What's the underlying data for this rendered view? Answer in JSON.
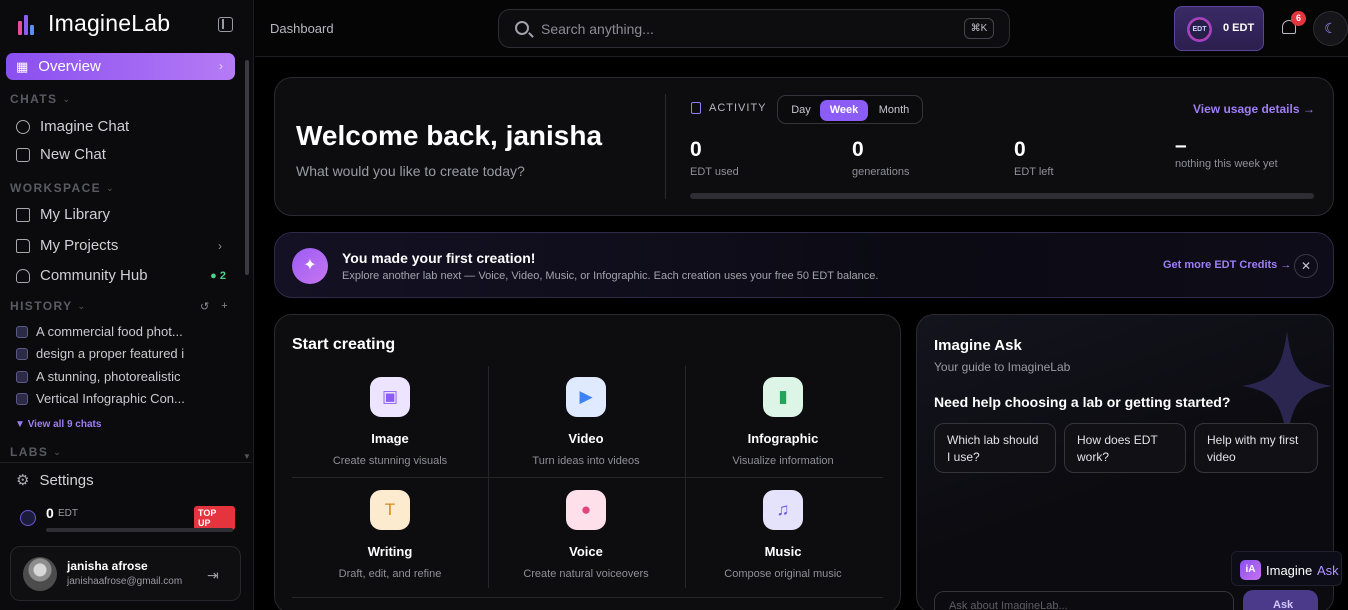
{
  "app": {
    "name": "ImagineLab"
  },
  "sidebar": {
    "overview": "Overview",
    "sections": {
      "chats": "CHATS",
      "workspace": "WORKSPACE",
      "history": "HISTORY",
      "labs": "LABS"
    },
    "chats": [
      "Imagine Chat",
      "New Chat"
    ],
    "workspace": [
      "My Library",
      "My Projects",
      "Community Hub"
    ],
    "community_count": "2",
    "history": [
      "A commercial food phot...",
      "design a proper featured i",
      "A stunning, photorealistic",
      "Vertical Infographic Con..."
    ],
    "view_all": "View all 9 chats",
    "settings": "Settings",
    "edt_balance": "0",
    "edt_unit": "EDT",
    "topup": "TOP UP",
    "user": {
      "name": "janisha afrose",
      "email": "janishaafrose@gmail.com"
    }
  },
  "topbar": {
    "breadcrumb": "Dashboard",
    "search_placeholder": "Search anything...",
    "shortcut": "⌘K",
    "edt_coin": "EDT",
    "edt_label": "0 EDT",
    "notifications": "6"
  },
  "welcome": {
    "title": "Welcome back, janisha",
    "subtitle": "What would you like to create today?",
    "activity_label": "ACTIVITY",
    "tabs": [
      "Day",
      "Week",
      "Month"
    ],
    "active_tab": "Week",
    "usage_link": "View usage details →",
    "stats": [
      {
        "value": "0",
        "label": "EDT used"
      },
      {
        "value": "0",
        "label": "generations"
      },
      {
        "value": "0",
        "label": "EDT left"
      },
      {
        "value": "–",
        "label": "nothing this week yet"
      }
    ],
    "progress": 0
  },
  "banner": {
    "title": "You made your first creation!",
    "subtitle": "Explore another lab next — Voice, Video, Music, or Infographic. Each creation uses your free 50 EDT balance.",
    "link": "Get more EDT Credits →",
    "close": "✕"
  },
  "create": {
    "title": "Start creating",
    "tiles": [
      {
        "name": "Image",
        "desc": "Create stunning visuals",
        "icon": "image-icon",
        "color": "#8b5cf6",
        "bg": "#ede4ff"
      },
      {
        "name": "Video",
        "desc": "Turn ideas into videos",
        "icon": "video-icon",
        "color": "#3b82f6",
        "bg": "#dfeaff"
      },
      {
        "name": "Infographic",
        "desc": "Visualize information",
        "icon": "bar-chart-icon",
        "color": "#22a45a",
        "bg": "#dcf5e6"
      },
      {
        "name": "Writing",
        "desc": "Draft, edit, and refine",
        "icon": "text-icon",
        "color": "#d98a1c",
        "bg": "#fdebd0"
      },
      {
        "name": "Voice",
        "desc": "Create natural voiceovers",
        "icon": "mic-icon",
        "color": "#e0457b",
        "bg": "#fde0ea"
      },
      {
        "name": "Music",
        "desc": "Compose original music",
        "icon": "music-icon",
        "color": "#6d55d8",
        "bg": "#e5e2fb"
      }
    ]
  },
  "ask": {
    "title": "Imagine Ask",
    "subtitle": "Your guide to ImagineLab",
    "question": "Need help choosing a lab or getting started?",
    "chips": [
      "Which lab should I use?",
      "How does EDT work?",
      "Help with my first video"
    ],
    "input_placeholder": "Ask about ImagineLab...",
    "send": "Ask"
  },
  "fab": {
    "mark": "iA",
    "label1": "Imagine",
    "label2": "Ask"
  }
}
